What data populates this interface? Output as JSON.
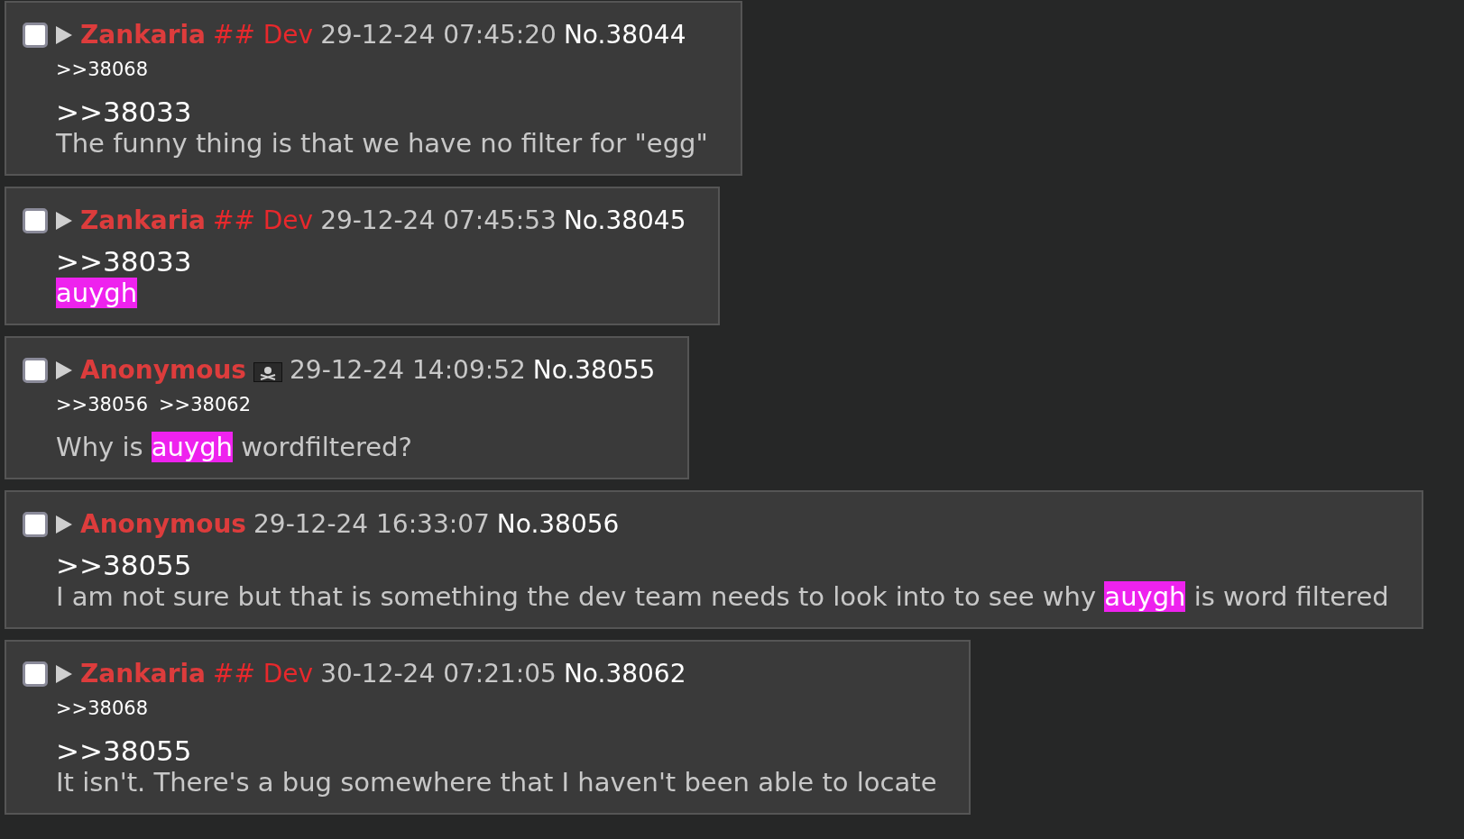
{
  "posts": [
    {
      "checked": false,
      "name": "Zankaria",
      "capcode": "## Dev",
      "flag": false,
      "date": "29-12-24 07:45:20",
      "number": "No.38044",
      "backlinks": [
        ">>38068"
      ],
      "lines": [
        [
          {
            "kind": "quote",
            "text": ">>38033"
          }
        ],
        [
          {
            "kind": "text",
            "text": "The funny thing is that we have no filter for \"egg\""
          }
        ]
      ]
    },
    {
      "checked": false,
      "name": "Zankaria",
      "capcode": "## Dev",
      "flag": false,
      "date": "29-12-24 07:45:53",
      "number": "No.38045",
      "lines": [
        [
          {
            "kind": "quote",
            "text": ">>38033"
          }
        ],
        [
          {
            "kind": "filtered",
            "text": "auygh"
          }
        ]
      ]
    },
    {
      "checked": false,
      "name": "Anonymous",
      "flag": true,
      "date": "29-12-24 14:09:52",
      "number": "No.38055",
      "backlinks": [
        ">>38056",
        ">>38062"
      ],
      "lines": [
        [
          {
            "kind": "text",
            "text": "Why is "
          },
          {
            "kind": "filtered",
            "text": "auygh"
          },
          {
            "kind": "text",
            "text": " wordfiltered?"
          }
        ]
      ]
    },
    {
      "checked": false,
      "name": "Anonymous",
      "flag": false,
      "date": "29-12-24 16:33:07",
      "number": "No.38056",
      "lines": [
        [
          {
            "kind": "quote",
            "text": ">>38055"
          }
        ],
        [
          {
            "kind": "text",
            "text": "I am not sure but that is something the dev team needs to look into to see why "
          },
          {
            "kind": "filtered",
            "text": "auygh"
          },
          {
            "kind": "text",
            "text": " is word filtered"
          }
        ]
      ]
    },
    {
      "checked": false,
      "name": "Zankaria",
      "capcode": "## Dev",
      "flag": false,
      "date": "30-12-24 07:21:05",
      "number": "No.38062",
      "backlinks": [
        ">>38068"
      ],
      "lines": [
        [
          {
            "kind": "quote",
            "text": ">>38055"
          }
        ],
        [
          {
            "kind": "text",
            "text": "It isn't. There's a bug somewhere that I haven't been able to locate"
          }
        ]
      ]
    }
  ]
}
